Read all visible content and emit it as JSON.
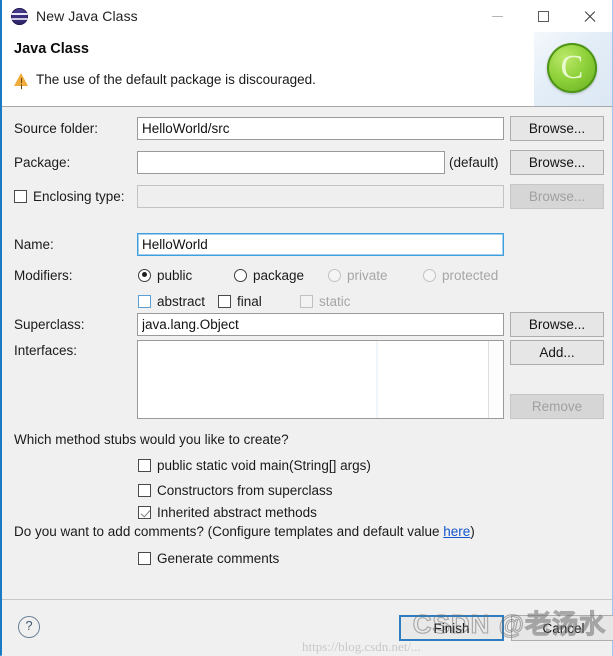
{
  "window": {
    "title": "New Java Class",
    "icon": "eclipse-sphere-icon",
    "controls": {
      "minimize": "minimize",
      "maximize": "maximize",
      "close": "close"
    }
  },
  "header": {
    "title": "Java Class",
    "message": "The use of the default package is discouraged.",
    "warning_icon": "warning-triangle-icon",
    "badge_letter": "C"
  },
  "fields": {
    "source_folder": {
      "label": "Source folder:",
      "value": "HelloWorld/src",
      "button": "Browse..."
    },
    "package": {
      "label": "Package:",
      "value": "",
      "suffix": "(default)",
      "button": "Browse..."
    },
    "enclosing_type": {
      "label": "Enclosing type:",
      "value": "",
      "checked": false,
      "button": "Browse...",
      "disabled": true
    },
    "name": {
      "label": "Name:",
      "value": "HelloWorld",
      "focused": true
    },
    "superclass": {
      "label": "Superclass:",
      "value": "java.lang.Object",
      "button": "Browse..."
    },
    "interfaces": {
      "label": "Interfaces:",
      "items": [],
      "add_button": "Add...",
      "remove_button": "Remove"
    }
  },
  "modifiers": {
    "label": "Modifiers:",
    "access": [
      {
        "label": "public",
        "selected": true,
        "disabled": false
      },
      {
        "label": "package",
        "selected": false,
        "disabled": false
      },
      {
        "label": "private",
        "selected": false,
        "disabled": true
      },
      {
        "label": "protected",
        "selected": false,
        "disabled": true
      }
    ],
    "flags": [
      {
        "label": "abstract",
        "checked": false,
        "disabled": false
      },
      {
        "label": "final",
        "checked": false,
        "disabled": false
      },
      {
        "label": "static",
        "checked": false,
        "disabled": true
      }
    ]
  },
  "stubs": {
    "question": "Which method stubs would you like to create?",
    "options": [
      {
        "label": "public static void main(String[] args)",
        "checked": false
      },
      {
        "label": "Constructors from superclass",
        "checked": false
      },
      {
        "label": "Inherited abstract methods",
        "checked": true
      }
    ]
  },
  "comments": {
    "question_prefix": "Do you want to add comments? (Configure templates and default value ",
    "link": "here",
    "question_suffix": ")",
    "option": {
      "label": "Generate comments",
      "checked": false
    }
  },
  "footer": {
    "help": "?",
    "finish": "Finish",
    "cancel": "Cancel"
  },
  "watermark": {
    "main": "CSDN @老汤水",
    "url": "https://blog.csdn.net/..."
  }
}
